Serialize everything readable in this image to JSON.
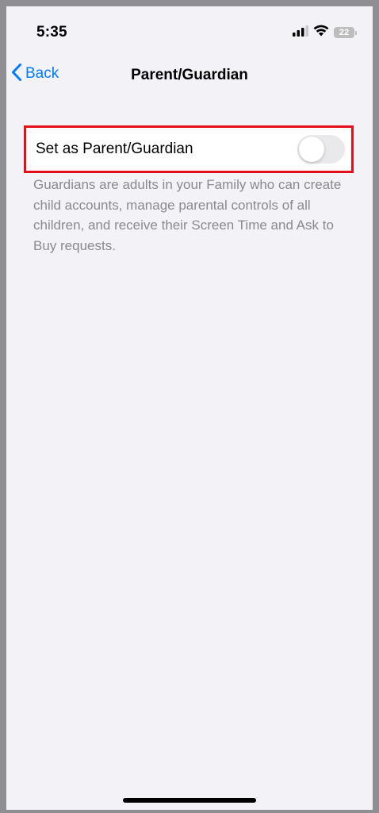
{
  "status_bar": {
    "time": "5:35",
    "battery_level": "22",
    "signal_icon": "cellular-signal-icon",
    "wifi_icon": "wifi-icon"
  },
  "nav": {
    "back_label": "Back",
    "back_icon": "chevron-left-icon",
    "title": "Parent/Guardian"
  },
  "settings": {
    "row_label": "Set as Parent/Guardian",
    "toggle_on": false,
    "footer": "Guardians are adults in your Family who can create child accounts, manage parental controls of all children, and receive their Screen Time and Ask to Buy requests."
  },
  "colors": {
    "accent": "#007aff",
    "highlight": "#e3101c",
    "background": "#f2f2f7",
    "toggle_off": "#e9e9eb"
  }
}
